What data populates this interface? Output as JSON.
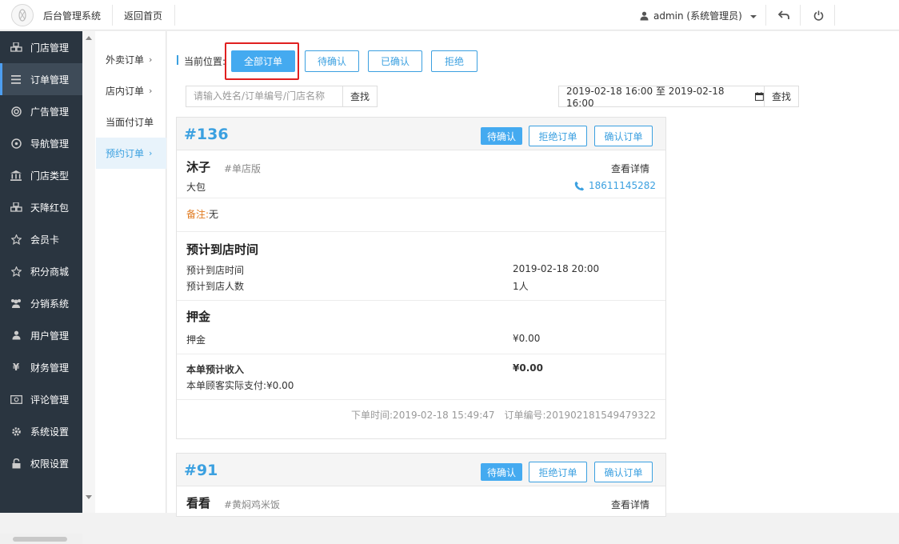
{
  "header": {
    "app_title": "后台管理系统",
    "back_home": "返回首页",
    "user": "admin (系统管理员)",
    "icons": [
      "user-icon",
      "undo-icon",
      "power-icon"
    ]
  },
  "sidebar": {
    "items": [
      {
        "label": "门店管理",
        "icon": "cubes-icon"
      },
      {
        "label": "订单管理",
        "icon": "list-icon",
        "active": true
      },
      {
        "label": "广告管理",
        "icon": "lifebuoy-icon"
      },
      {
        "label": "导航管理",
        "icon": "compass-icon"
      },
      {
        "label": "门店类型",
        "icon": "bank-icon"
      },
      {
        "label": "天降红包",
        "icon": "cubes-icon"
      },
      {
        "label": "会员卡",
        "icon": "star-icon"
      },
      {
        "label": "积分商城",
        "icon": "star-icon"
      },
      {
        "label": "分销系统",
        "icon": "users-icon"
      },
      {
        "label": "用户管理",
        "icon": "user-icon"
      },
      {
        "label": "财务管理",
        "icon": "yen-icon"
      },
      {
        "label": "评论管理",
        "icon": "comment-icon"
      },
      {
        "label": "系统设置",
        "icon": "gear-icon"
      },
      {
        "label": "权限设置",
        "icon": "lock-icon"
      }
    ]
  },
  "submenu": {
    "items": [
      {
        "label": "外卖订单",
        "chevron": "›"
      },
      {
        "label": "店内订单",
        "chevron": "›"
      },
      {
        "label": "当面付订单",
        "chevron": ""
      },
      {
        "label": "预约订单",
        "chevron": "›",
        "active": true
      }
    ]
  },
  "filters": {
    "location_label": "当前位置:",
    "buttons": [
      "全部订单",
      "待确认",
      "已确认",
      "拒绝"
    ],
    "active": "全部订单"
  },
  "search": {
    "placeholder": "请输入姓名/订单编号/门店名称",
    "button": "查找",
    "date_range": "2019-02-18 16:00 至 2019-02-18 16:00",
    "date_button": "查找"
  },
  "orders": [
    {
      "number": "#136",
      "status": "待确认",
      "reject_label": "拒绝订单",
      "confirm_label": "确认订单",
      "customer": "沐子",
      "store_tag": "#单店版",
      "detail_label": "查看详情",
      "item": "大包",
      "phone": "18611145282",
      "remark_label": "备注:",
      "remark_value": "无",
      "arrival_title": "预计到店时间",
      "arrival_time_label": "预计到店时间",
      "arrival_time_value": "2019-02-18 20:00",
      "arrival_people_label": "预计到店人数",
      "arrival_people_value": "1人",
      "deposit_title": "押金",
      "deposit_label": "押金",
      "deposit_value": "¥0.00",
      "income_label": "本单预计收入",
      "income_value": "¥0.00",
      "paid_label": "本单顾客实际支付:¥0.00",
      "order_time": "下单时间:2019-02-18 15:49:47",
      "order_serial": "订单编号:201902181549479322"
    },
    {
      "number": "#91",
      "status": "待确认",
      "reject_label": "拒绝订单",
      "confirm_label": "确认订单",
      "customer": "看看",
      "store_tag": "#黄焖鸡米饭",
      "detail_label": "查看详情"
    }
  ]
}
